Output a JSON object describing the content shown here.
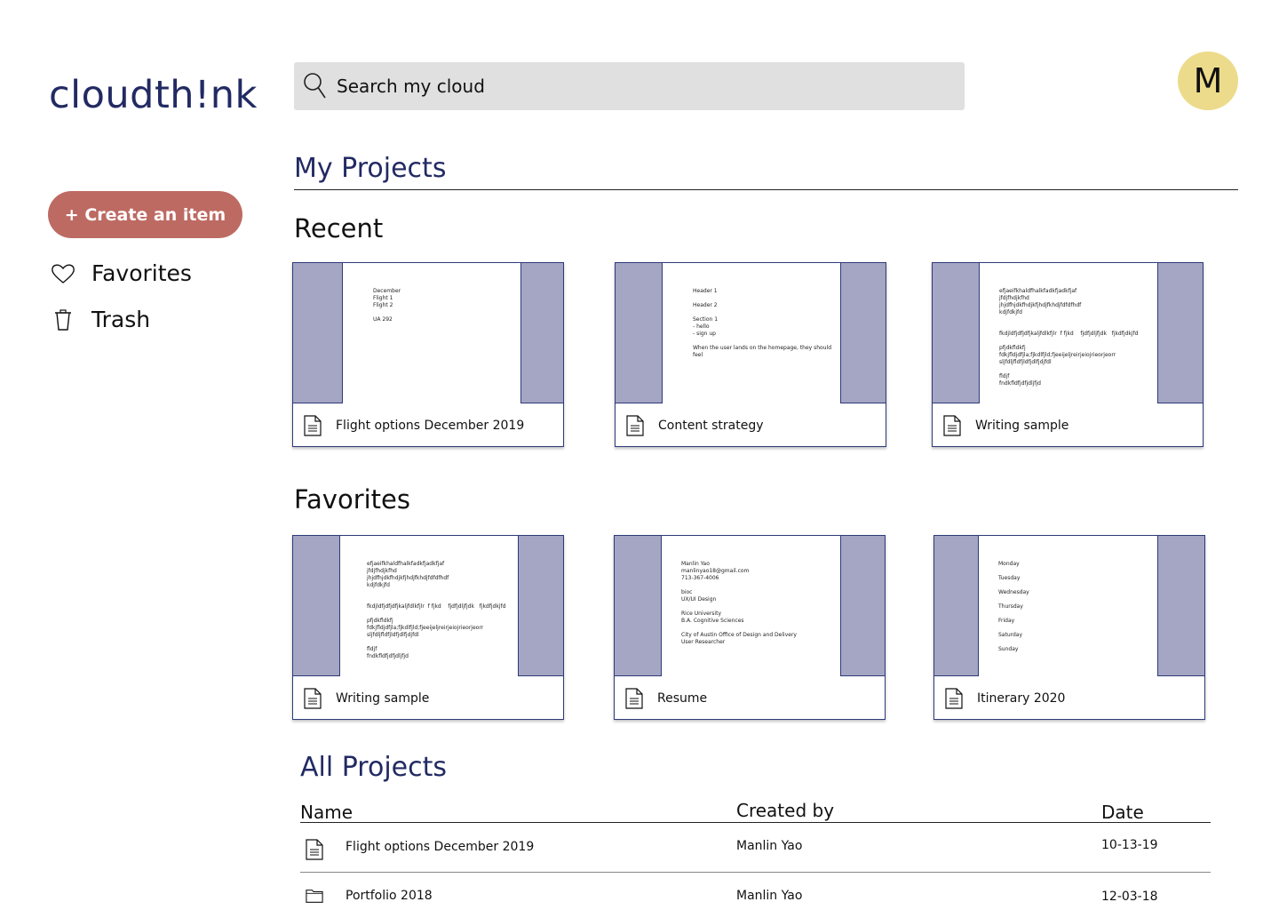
{
  "app": {
    "logo": "cloudth!nk"
  },
  "search": {
    "placeholder": "Search my cloud"
  },
  "avatar": {
    "initial": "M"
  },
  "sidebar": {
    "create_label": "+ Create an item",
    "items": [
      {
        "label": "Favorites",
        "icon": "heart-icon"
      },
      {
        "label": "Trash",
        "icon": "trash-icon"
      }
    ]
  },
  "main": {
    "title": "My Projects",
    "recent_title": "Recent",
    "favorites_title": "Favorites",
    "all_title": "All Projects"
  },
  "recent": [
    {
      "name": "Flight options December 2019",
      "lines": [
        "December",
        "Flight 1",
        "Flight 2",
        "",
        "UA 292"
      ]
    },
    {
      "name": "Content strategy",
      "lines": [
        "Header 1",
        "",
        "Header 2",
        "",
        "Section 1",
        "- hello",
        "- sign up",
        "",
        "When the user lands on the homepage, they should",
        "feel"
      ]
    },
    {
      "name": "Writing sample",
      "lines": [
        "efjaeifkhaldfhalkfadkfjadkfjaf",
        "jfdjfhdjkfhd",
        "jhjdfhjdkfhdjkfjhdjfkhdjfdfdfhdf",
        "kdjfdkjfd",
        "",
        "",
        "fkdjldfjdfjdfjkaljfdlkfjlr  f fjkd    fjdfjdljfjdk   fjkdfjdkjfd",
        "",
        "pfjdkfldkfj",
        "fdkjfldjdfjla;fjkdlfjld;fjeeijeljreirjeiojrieorjeorr",
        "sljfdljfldfjldfjdlfjdjfdl",
        "",
        "fldjf",
        "fndkfldfjdfjdljfjd"
      ]
    }
  ],
  "favorites": [
    {
      "name": "Writing sample",
      "lines": [
        "efjaeifkhaldfhalkfadkfjadkfjaf",
        "jfdjfhdjkfhd",
        "jhjdfhjdkfhdjkfjhdjfkhdjfdfdfhdf",
        "kdjfdkjfd",
        "",
        "",
        "fkdjldfjdfjdfjkaljfdlkfjlr  f fjkd    fjdfjdljfjdk   fjkdfjdkjfd",
        "",
        "pfjdkfldkfj",
        "fdkjfldjdfjla;fjkdlfjld;fjeeijeljreirjeiojrieorjeorr",
        "sljfdljfldfjldfjdlfjdjfdl",
        "",
        "fldjf",
        "fndkfldfjdfjdljfjd"
      ]
    },
    {
      "name": "Resume",
      "lines": [
        "Manlin Yao",
        "manlinyao18@gmail.com",
        "713-367-4006",
        "",
        "bioc",
        "UX/UI Design",
        "",
        "Rice University",
        "B.A. Cognitive Sciences",
        "",
        "City of Austin Office of Design and Delivery",
        "User Researcher"
      ]
    },
    {
      "name": "Itinerary 2020",
      "lines": [
        "Monday",
        "",
        "Tuesday",
        "",
        "Wednesday",
        "",
        "Thursday",
        "",
        "Friday",
        "",
        "Saturday",
        "",
        "Sunday"
      ]
    }
  ],
  "all_projects": {
    "columns": [
      "Name",
      "Created by",
      "Date"
    ],
    "rows": [
      {
        "name": "Flight options December 2019",
        "created_by": "Manlin Yao",
        "date": "10-13-19",
        "icon": "document-icon"
      },
      {
        "name": "Portfolio 2018",
        "created_by": "Manlin Yao",
        "date": "12-03-18",
        "icon": "folder-icon"
      }
    ]
  },
  "colors": {
    "brand": "#222a63",
    "create_button": "#bd6a63",
    "avatar": "#ecdb8b",
    "thumb_margin": "#a4a6c3",
    "search_bg": "#e0e0e0"
  }
}
